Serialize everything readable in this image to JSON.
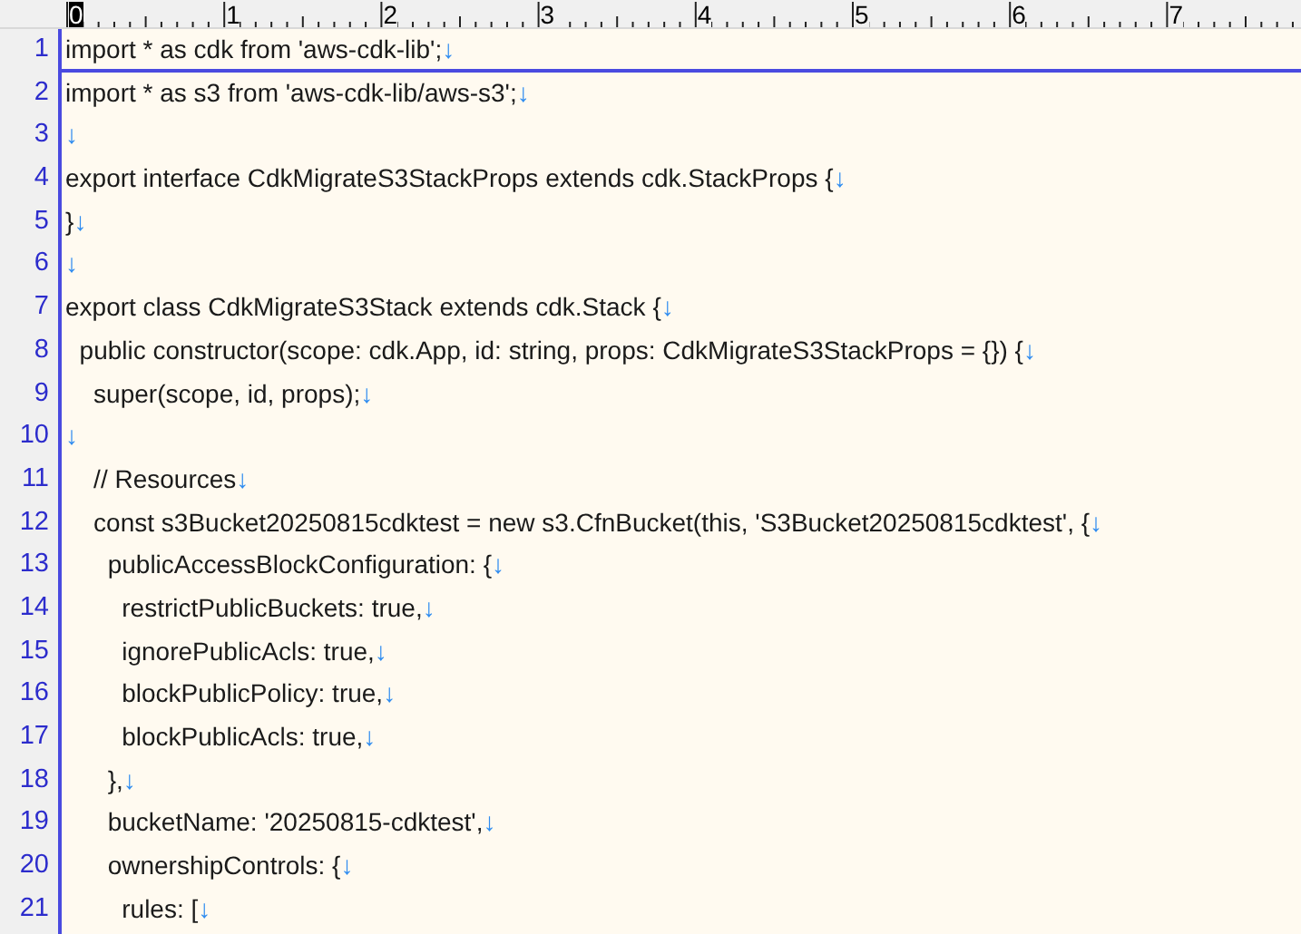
{
  "ruler": {
    "labels": [
      "0",
      "1",
      "2",
      "3",
      "4",
      "5",
      "6",
      "7"
    ]
  },
  "lines": [
    {
      "number": "1",
      "text": "import * as cdk from 'aws-cdk-lib';",
      "eol": "↓",
      "cursor": true
    },
    {
      "number": "2",
      "text": "import * as s3 from 'aws-cdk-lib/aws-s3';",
      "eol": "↓",
      "cursor": false
    },
    {
      "number": "3",
      "eol": "↓",
      "cursor": false
    },
    {
      "number": "4",
      "text": "export interface CdkMigrateS3StackProps extends cdk.StackProps {",
      "eol": "↓",
      "cursor": false
    },
    {
      "number": "5",
      "text": "}",
      "eol": "↓",
      "cursor": false
    },
    {
      "number": "6",
      "eol": "↓",
      "cursor": false
    },
    {
      "number": "7",
      "text": "export class CdkMigrateS3Stack extends cdk.Stack {",
      "eol": "↓",
      "cursor": false
    },
    {
      "number": "8",
      "text": "  public constructor(scope: cdk.App, id: string, props: CdkMigrateS3StackProps = {}) {",
      "eol": "↓",
      "cursor": false
    },
    {
      "number": "9",
      "text": "    super(scope, id, props);",
      "eol": "↓",
      "cursor": false
    },
    {
      "number": "10",
      "eol": "↓",
      "cursor": false
    },
    {
      "number": "11",
      "text": "    // Resources",
      "eol": "↓",
      "cursor": false
    },
    {
      "number": "12",
      "text": "    const s3Bucket20250815cdktest = new s3.CfnBucket(this, 'S3Bucket20250815cdktest', {",
      "eol": "↓",
      "cursor": false
    },
    {
      "number": "13",
      "text": "      publicAccessBlockConfiguration: {",
      "eol": "↓",
      "cursor": false
    },
    {
      "number": "14",
      "text": "        restrictPublicBuckets: true,",
      "eol": "↓",
      "cursor": false
    },
    {
      "number": "15",
      "text": "        ignorePublicAcls: true,",
      "eol": "↓",
      "cursor": false
    },
    {
      "number": "16",
      "text": "        blockPublicPolicy: true,",
      "eol": "↓",
      "cursor": false
    },
    {
      "number": "17",
      "text": "        blockPublicAcls: true,",
      "eol": "↓",
      "cursor": false
    },
    {
      "number": "18",
      "text": "      },",
      "eol": "↓",
      "cursor": false
    },
    {
      "number": "19",
      "text": "      bucketName: '20250815-cdktest',",
      "eol": "↓",
      "cursor": false
    },
    {
      "number": "20",
      "text": "      ownershipControls: {",
      "eol": "↓",
      "cursor": false
    },
    {
      "number": "21",
      "text": "        rules: [",
      "eol": "↓",
      "cursor": false
    }
  ]
}
